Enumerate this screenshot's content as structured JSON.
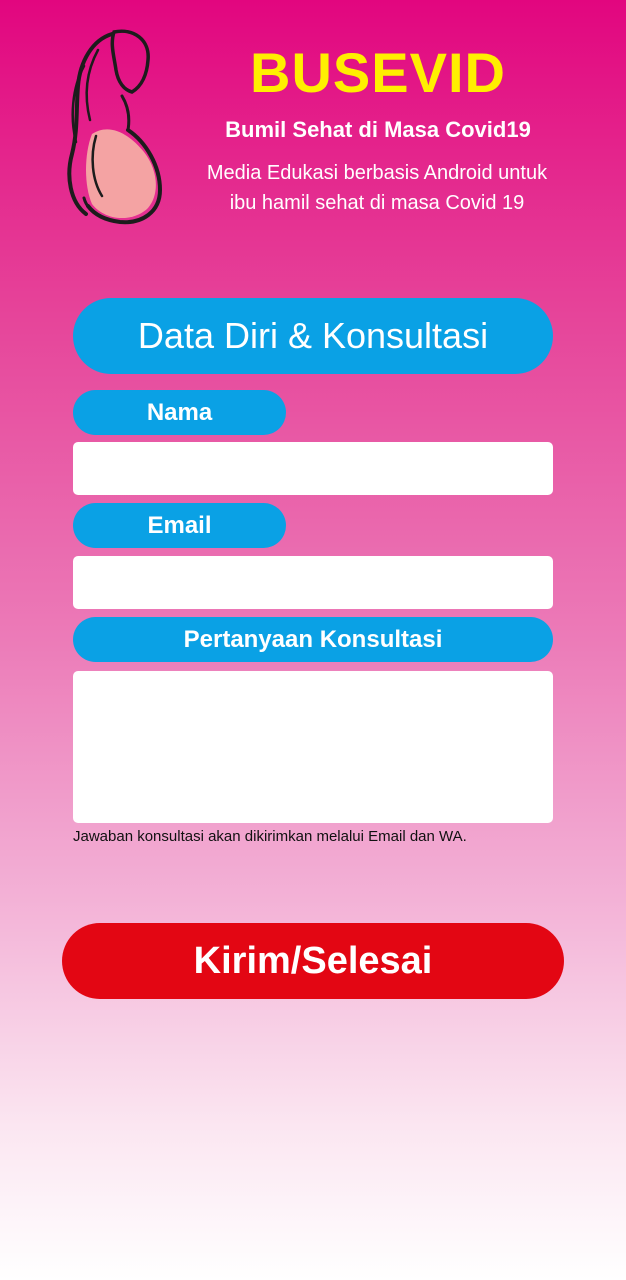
{
  "header": {
    "app_title": "BUSEVID",
    "subtitle": "Bumil Sehat di Masa Covid19",
    "description_line1": "Media Edukasi berbasis Android untuk",
    "description_line2": "ibu hamil sehat di masa Covid 19",
    "logo_icon": "pregnant-woman-icon"
  },
  "form": {
    "section_title": "Data Diri & Konsultasi",
    "nama_label": "Nama",
    "nama_value": "",
    "email_label": "Email",
    "email_value": "",
    "pertanyaan_label": "Pertanyaan Konsultasi",
    "pertanyaan_value": "",
    "note": "Jawaban konsultasi akan dikirimkan melalui Email dan WA.",
    "submit_label": "Kirim/Selesai"
  },
  "colors": {
    "title_yellow": "#ffef00",
    "label_blue": "#0aa1e5",
    "submit_red": "#e30613",
    "bg_top_magenta": "#e2067f"
  }
}
